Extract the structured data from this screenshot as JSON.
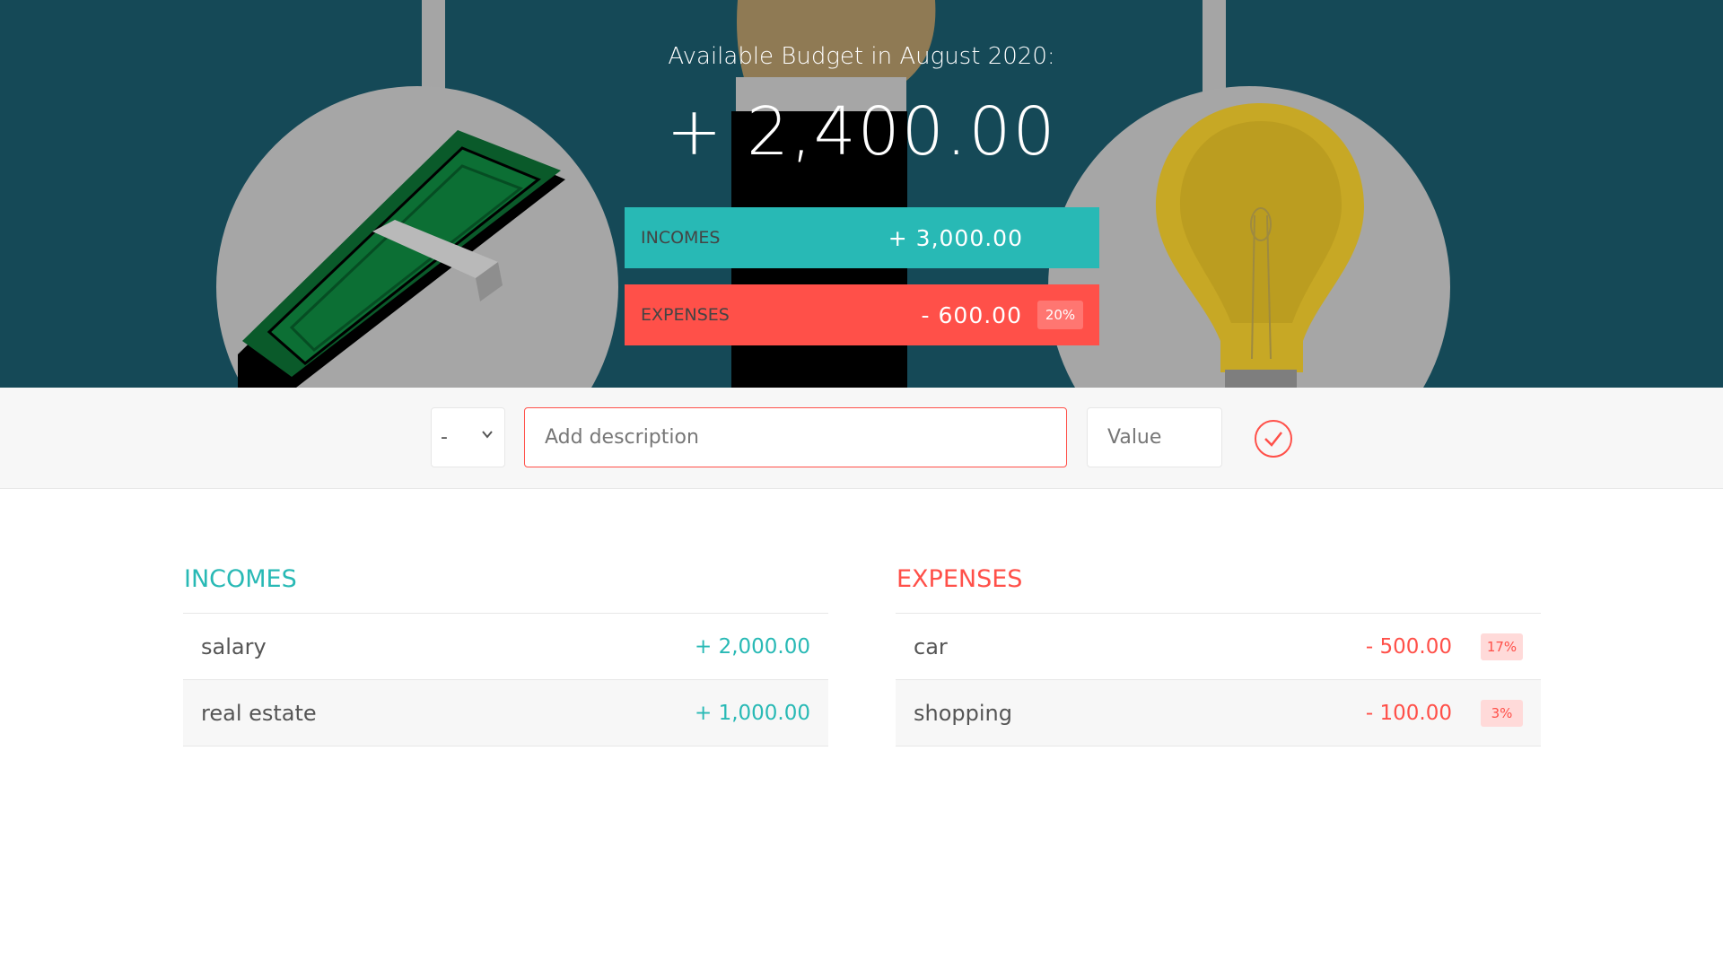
{
  "budget": {
    "title": "Available Budget in August 2020:",
    "value": "+ 2,400.00",
    "income_label": "Incomes",
    "income_value": "+ 3,000.00",
    "expenses_label": "Expenses",
    "expenses_value": "- 600.00",
    "expenses_percentage": "20%"
  },
  "add": {
    "type_value": "-",
    "description_placeholder": "Add description",
    "value_placeholder": "Value"
  },
  "incomes": {
    "title": "Incomes",
    "items": [
      {
        "description": "salary",
        "value": "+ 2,000.00"
      },
      {
        "description": "real estate",
        "value": "+ 1,000.00"
      }
    ]
  },
  "expenses": {
    "title": "Expenses",
    "items": [
      {
        "description": "car",
        "value": "- 500.00",
        "percentage": "17%"
      },
      {
        "description": "shopping",
        "value": "- 100.00",
        "percentage": "3%"
      }
    ]
  },
  "colors": {
    "income": "#28b9b5",
    "expense": "#ff5049",
    "hero_background": "#154957"
  }
}
